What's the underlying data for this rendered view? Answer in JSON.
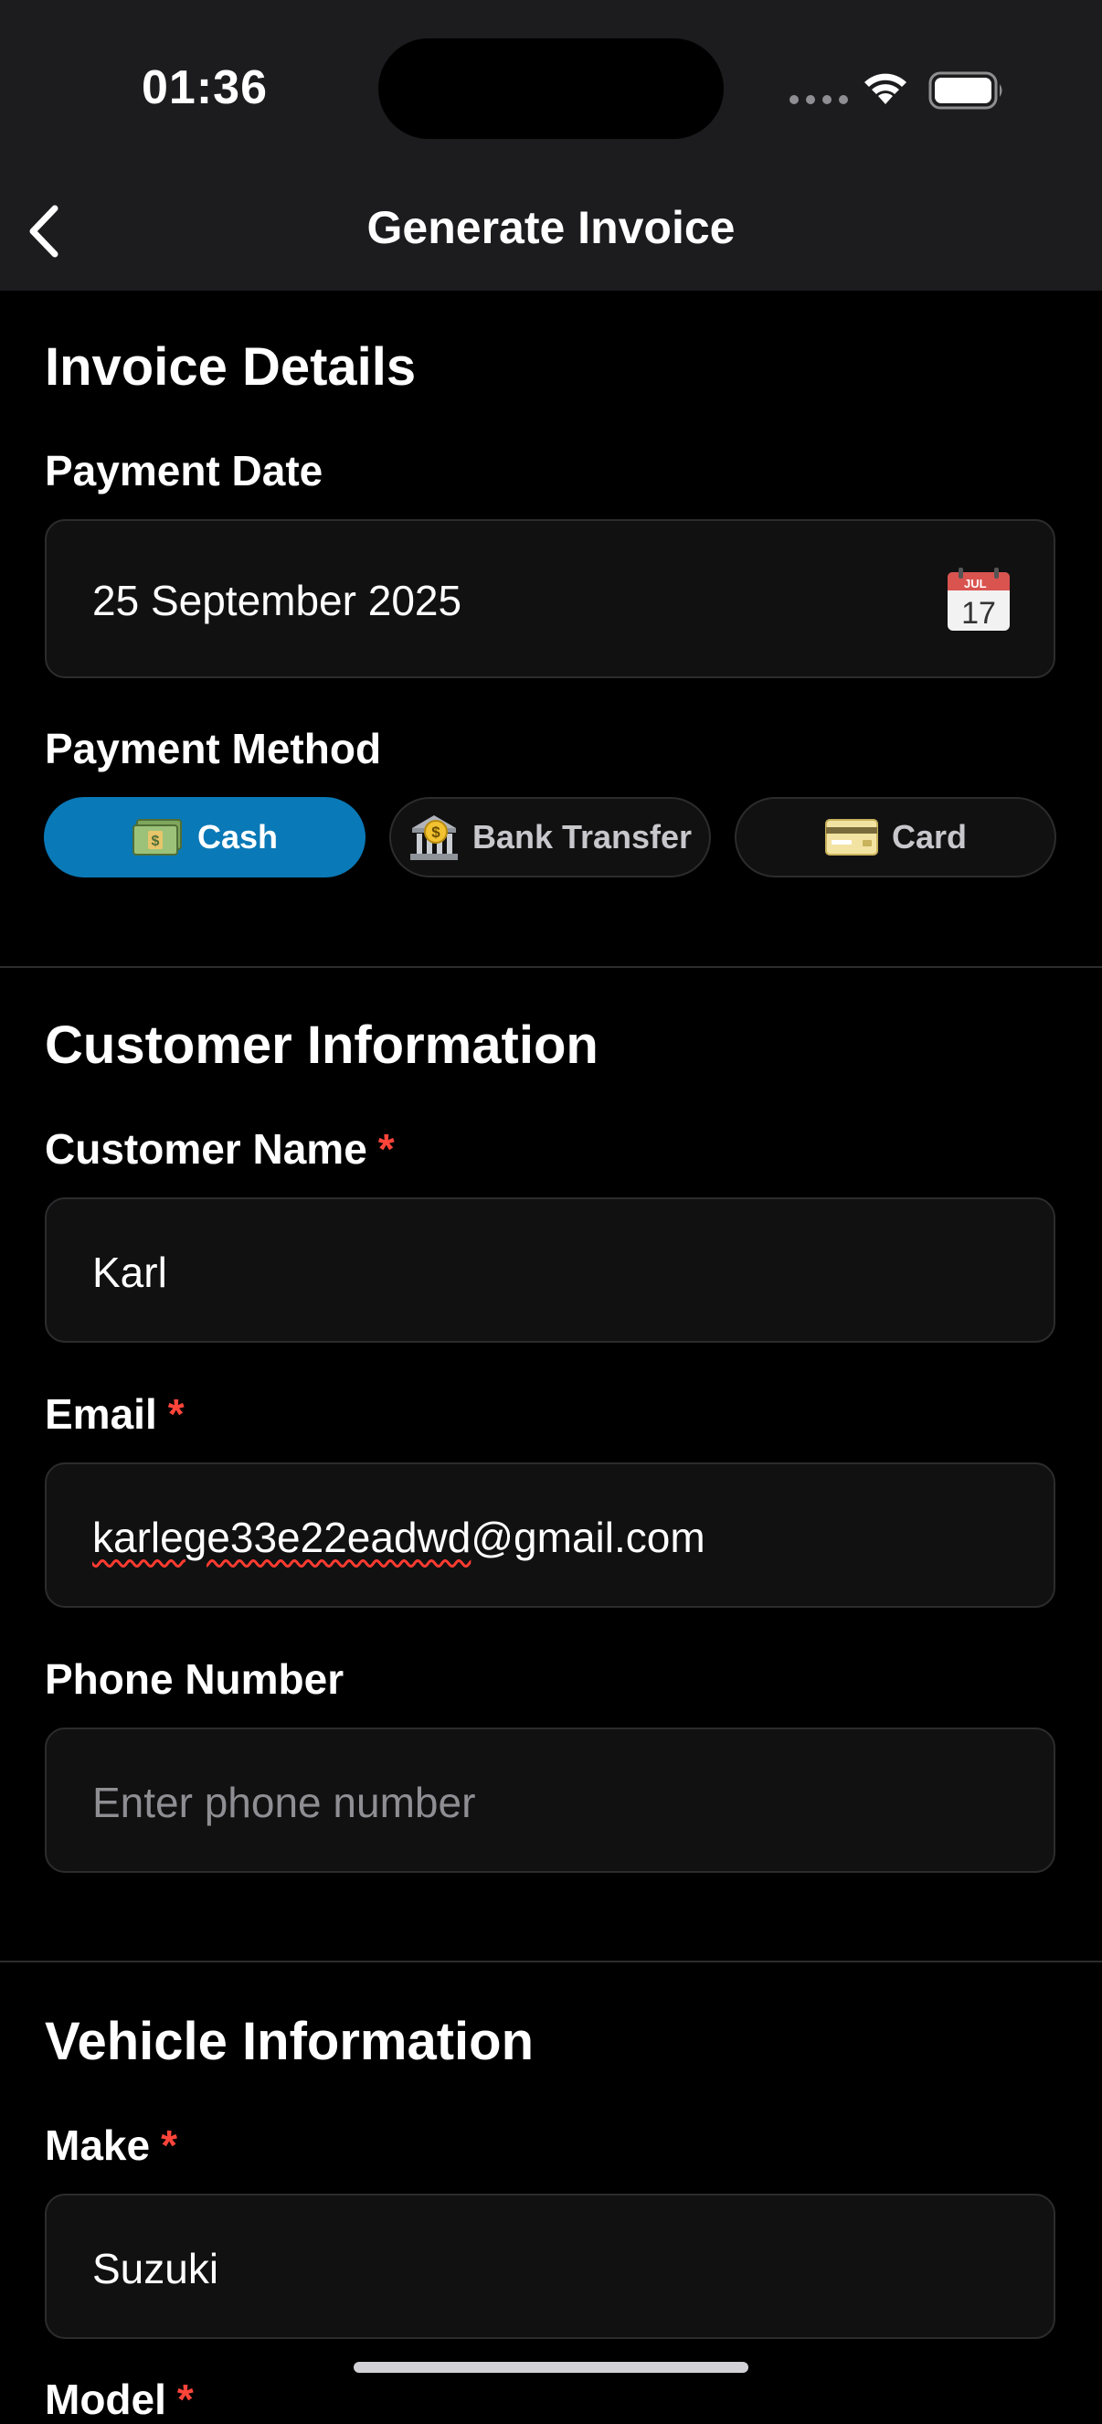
{
  "status_bar": {
    "time": "01:36"
  },
  "header": {
    "title": "Generate Invoice"
  },
  "invoice_details": {
    "title": "Invoice Details",
    "payment_date_label": "Payment Date",
    "payment_date_value": "25 September 2025",
    "calendar_month": "JUL",
    "calendar_day": "17",
    "payment_method_label": "Payment Method",
    "methods": [
      {
        "label": "Cash",
        "selected": true
      },
      {
        "label": "Bank Transfer",
        "selected": false
      },
      {
        "label": "Card",
        "selected": false
      }
    ]
  },
  "customer": {
    "title": "Customer Information",
    "name_label": "Customer Name",
    "name_value": "Karl",
    "email_label": "Email",
    "email_value_misspelled": "karlege33e22eadwd",
    "email_value_rest": "@gmail.com",
    "phone_label": "Phone Number",
    "phone_placeholder": "Enter phone number",
    "required_mark": "*"
  },
  "vehicle": {
    "title": "Vehicle Information",
    "make_label": "Make",
    "make_value": "Suzuki",
    "model_label_partial": "Model"
  },
  "colors": {
    "accent": "#0a79b7",
    "required": "#ff453a",
    "background": "#000000",
    "field_bg": "#111112"
  }
}
